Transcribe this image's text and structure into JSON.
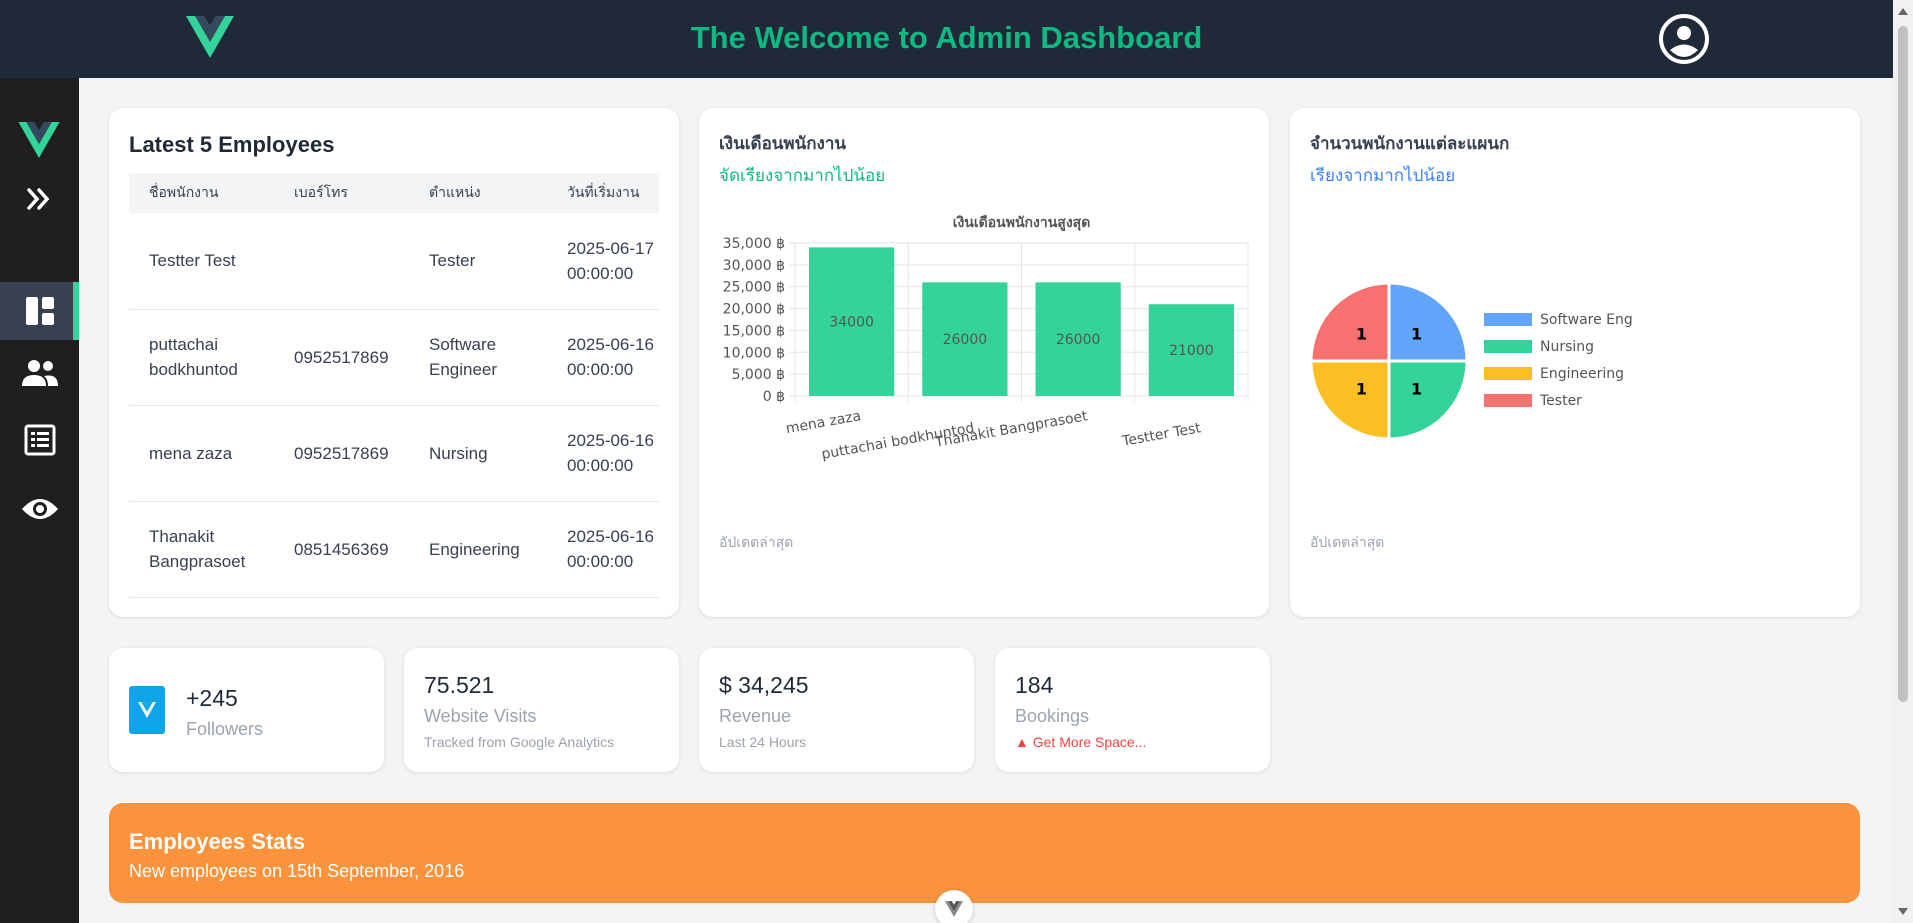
{
  "header": {
    "title": "The Welcome to Admin Dashboard"
  },
  "sidebar": {
    "items": [
      {
        "icon": "dashboard-icon",
        "active": true
      },
      {
        "icon": "people-icon",
        "active": false
      },
      {
        "icon": "list-icon",
        "active": false
      },
      {
        "icon": "eye-icon",
        "active": false
      }
    ]
  },
  "employees": {
    "title": "Latest 5 Employees",
    "columns": [
      "ชื่อพนักงาน",
      "เบอร์โทร",
      "ตำแหน่ง",
      "วันที่เริ่มงาน"
    ],
    "rows": [
      {
        "name": "Testter Test",
        "phone": "",
        "position": "Tester",
        "start": "2025-06-17 00:00:00"
      },
      {
        "name": "puttachai bodkhuntod",
        "phone": "0952517869",
        "position": "Software Engineer",
        "start": "2025-06-16 00:00:00"
      },
      {
        "name": "mena zaza",
        "phone": "0952517869",
        "position": "Nursing",
        "start": "2025-06-16 00:00:00"
      },
      {
        "name": "Thanakit Bangprasoet",
        "phone": "0851456369",
        "position": "Engineering",
        "start": "2025-06-16 00:00:00"
      }
    ]
  },
  "salary_card": {
    "title": "เงินเดือนพนักงาน",
    "subtitle": "จัดเรียงจากมากไปน้อย",
    "subtitle_color": "#10b981",
    "footer": "อัปเดตล่าสุด"
  },
  "dept_card": {
    "title": "จำนวนพนักงานแต่ละแผนก",
    "subtitle": "เรียงจากมากไปน้อย",
    "subtitle_color": "#3b82f6",
    "footer": "อัปเดตล่าสุด"
  },
  "chart_data": [
    {
      "type": "bar",
      "title": "เงินเดือนพนักงานสูงสุด",
      "categories": [
        "mena zaza",
        "puttachai bodkhuntod",
        "Thanakit Bangprasoet",
        "Testter Test"
      ],
      "values": [
        34000,
        26000,
        26000,
        21000
      ],
      "ylim": [
        0,
        35000
      ],
      "yticks": [
        "0 ฿",
        "5,000 ฿",
        "10,000 ฿",
        "15,000 ฿",
        "20,000 ฿",
        "25,000 ฿",
        "30,000 ฿",
        "35,000 ฿"
      ],
      "grid": true,
      "color": "#34d399"
    },
    {
      "type": "pie",
      "labels": [
        "Software Eng",
        "Nursing",
        "Engineering",
        "Tester"
      ],
      "values": [
        1,
        1,
        1,
        1
      ],
      "colors": [
        "#60a5fa",
        "#34d399",
        "#fbbf24",
        "#f87171"
      ],
      "legend": "right"
    }
  ],
  "stats": [
    {
      "value": "+245",
      "label": "Followers",
      "note": ""
    },
    {
      "value": "75.521",
      "label": "Website Visits",
      "note": "Tracked from Google Analytics"
    },
    {
      "value": "$ 34,245",
      "label": "Revenue",
      "note": "Last 24 Hours"
    },
    {
      "value": "184",
      "label": "Bookings",
      "note": "▲ Get More Space..."
    }
  ],
  "banner": {
    "title": "Employees Stats",
    "subtitle": "New employees on 15th September, 2016"
  }
}
